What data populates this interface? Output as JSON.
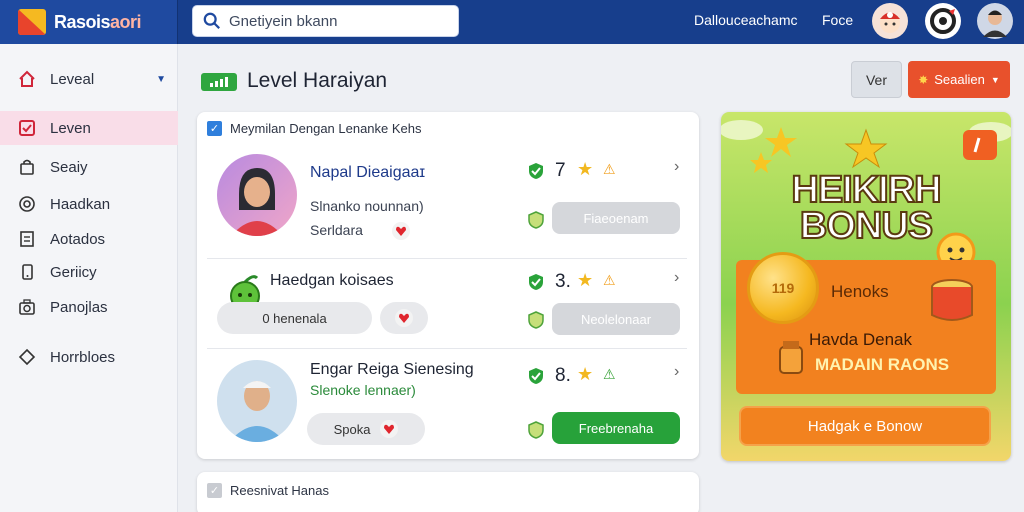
{
  "topbar": {
    "brand_left": "Ras",
    "brand_mid": "ois",
    "brand_right": "aori",
    "search_placeholder": "Gnetiyein bkann",
    "link_1": "Dallouceachamc",
    "link_2": "Foce"
  },
  "sidebar": {
    "items": [
      {
        "label": "Leveal",
        "icon": "home-icon"
      },
      {
        "label": "Leven",
        "icon": "check-square-icon"
      },
      {
        "label": "Seaiy",
        "icon": "bag-icon"
      },
      {
        "label": "Haadkan",
        "icon": "target-icon"
      },
      {
        "label": "Aotados",
        "icon": "list-icon"
      },
      {
        "label": "Geriicy",
        "icon": "phone-icon"
      },
      {
        "label": "Panojlas",
        "icon": "camera-icon"
      },
      {
        "label": "Horrbloes",
        "icon": "diamond-icon"
      }
    ]
  },
  "header": {
    "badge": "lvl",
    "title": "Level Haraiyan",
    "ver_button": "Ver",
    "sagan_button": "Seaalien"
  },
  "card": {
    "heading": "Meymilan Dengan Lenanke Kehs",
    "rows": [
      {
        "name": "Napal Dieaigaaɪ",
        "subtitle": "Slnanko nounnan)",
        "tag": "Serldara",
        "level": "7",
        "action": "Fiaeoenam"
      },
      {
        "name": "Haedgan koisaes",
        "subtitle": "",
        "tag": "0 henenala",
        "level": "3.",
        "action": "Neolelonaar"
      },
      {
        "name": "Engar Reiga Sienesing",
        "subtitle": "Slenoke lennaer)",
        "tag": "Spoka",
        "level": "8.",
        "action": "Freebrenaha"
      }
    ]
  },
  "card2": {
    "heading": "Reesnivat Hanas"
  },
  "bonus": {
    "title_1": "HEIKIRH",
    "title_2": "BONUS",
    "coin_text": "119",
    "label_1": "Henoks",
    "label_2": "Havda Denak",
    "label_3": "MADAIN RAONS",
    "button": "Hadgak e Bonow"
  },
  "colors": {
    "topbar": "#173e8c",
    "accent_green": "#27a23a",
    "accent_orange": "#f2821f",
    "accent_red": "#e8512c"
  }
}
